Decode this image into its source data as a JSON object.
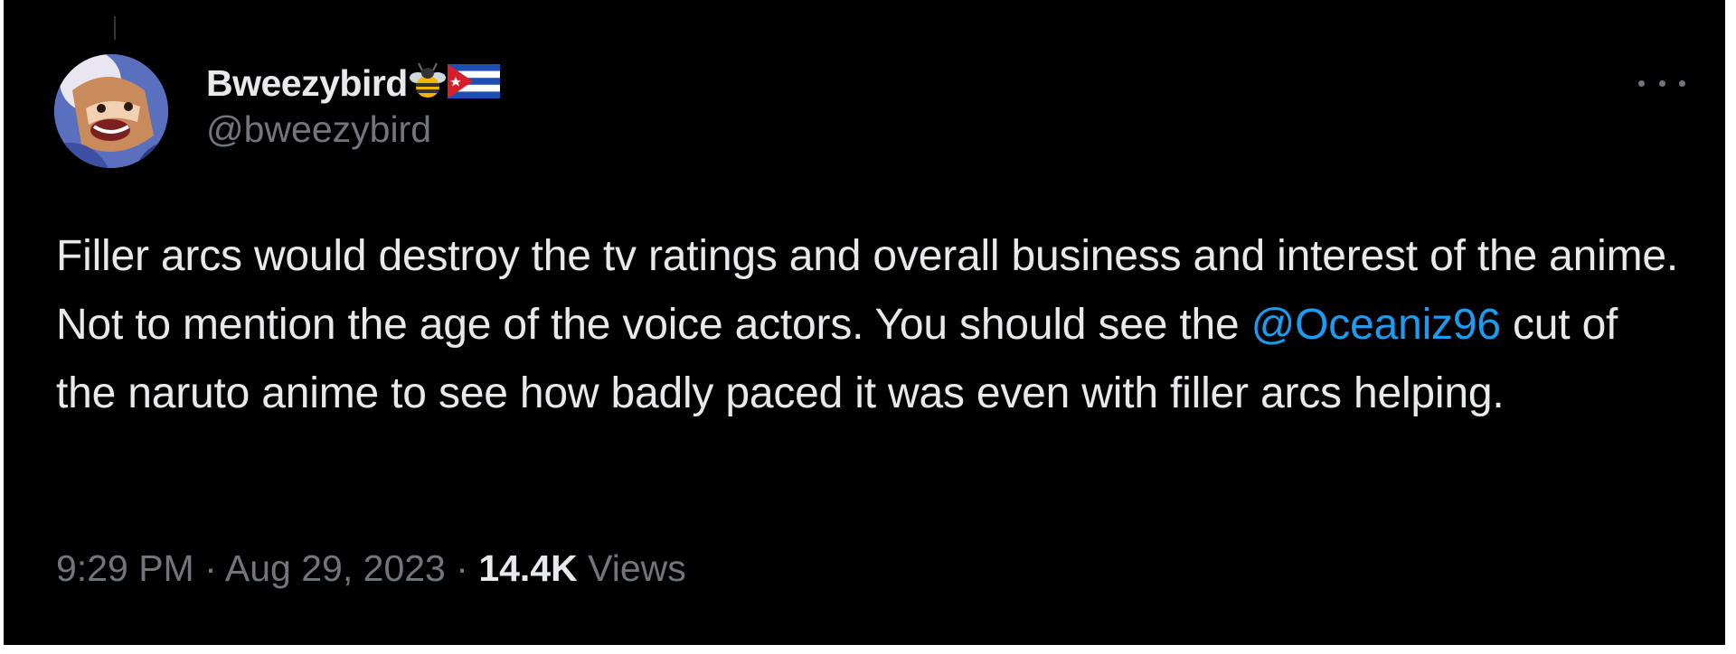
{
  "tweet": {
    "author": {
      "display_name": "Bweezybird",
      "display_emojis": [
        "bee-icon",
        "cuba-flag-icon"
      ],
      "handle": "@bweezybird"
    },
    "body": {
      "part1": "Filler arcs would destroy the tv ratings and overall business and interest of the anime. Not to mention the age of the voice actors. You should see the ",
      "mention": "@Oceaniz96",
      "part2": " cut of the naruto anime to see how badly paced it was even with filler arcs helping."
    },
    "meta": {
      "time": "9:29 PM",
      "separator": "·",
      "date": "Aug 29, 2023",
      "views_count": "14.4K",
      "views_label": "Views"
    },
    "more_icon": "more-icon"
  },
  "colors": {
    "background": "#000000",
    "text_primary": "#e7e9ea",
    "text_secondary": "#71767b",
    "accent": "#1d9bf0"
  }
}
